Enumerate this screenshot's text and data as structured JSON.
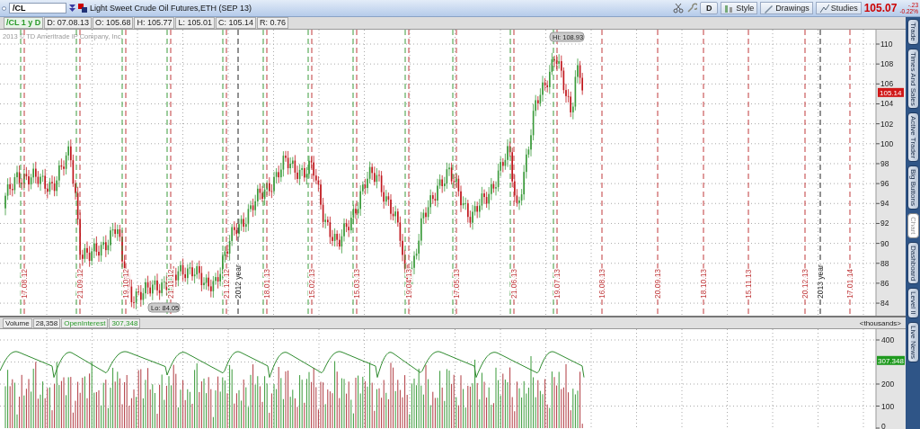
{
  "header": {
    "symbol": "/CL",
    "instrument": "Light Sweet Crude Oil Futures,ETH (SEP 13)",
    "toolbar": [
      {
        "label": "D",
        "kind": "period"
      },
      {
        "label": "Style",
        "kind": "style"
      },
      {
        "label": "Drawings",
        "kind": "drawings"
      },
      {
        "label": "Studies",
        "kind": "studies"
      }
    ],
    "last": "105.07",
    "change": "-.23",
    "change_pct": "-0.22%"
  },
  "quote_bar": [
    {
      "text": "/CL 1 y D",
      "kind": "symbol"
    },
    {
      "text": "D: 07.08.13",
      "kind": "field"
    },
    {
      "text": "O: 105.68",
      "kind": "field"
    },
    {
      "text": "H: 105.77",
      "kind": "field"
    },
    {
      "text": "L: 105.01",
      "kind": "field"
    },
    {
      "text": "C: 105.14",
      "kind": "field"
    },
    {
      "text": "R: 0.76",
      "kind": "field"
    }
  ],
  "price_chart": {
    "copyright": "2013 © TD Ameritrade IP Company, Inc.",
    "y_labels": [
      "110",
      "108",
      "106",
      "104",
      "102",
      "100",
      "98",
      "96",
      "94",
      "92",
      "90",
      "88",
      "86",
      "84"
    ],
    "current_price": "105.14",
    "high_label": "Hi: 108.93",
    "low_label": "Lo: 84.05",
    "date_markers": [
      {
        "label": "17.08.12",
        "kind": "date",
        "expiry": true
      },
      {
        "label": "21.09.12",
        "kind": "date",
        "expiry": true
      },
      {
        "label": "19.10.12",
        "kind": "date",
        "expiry": true
      },
      {
        "label": "21.11.12",
        "kind": "date",
        "expiry": true
      },
      {
        "label": "21.12.12",
        "kind": "date",
        "expiry": true
      },
      {
        "label": "2012 year",
        "kind": "year",
        "expiry": false
      },
      {
        "label": "18.01.13",
        "kind": "date",
        "expiry": true
      },
      {
        "label": "15.02.13",
        "kind": "date",
        "expiry": true
      },
      {
        "label": "15.03.13",
        "kind": "date",
        "expiry": true
      },
      {
        "label": "19.04.13",
        "kind": "date",
        "expiry": true
      },
      {
        "label": "17.05.13",
        "kind": "date",
        "expiry": true
      },
      {
        "label": "21.06.13",
        "kind": "date",
        "expiry": true
      },
      {
        "label": "19.07.13",
        "kind": "date",
        "expiry": true
      },
      {
        "label": "16.08.13",
        "kind": "date",
        "expiry": false
      },
      {
        "label": "20.09.13",
        "kind": "date",
        "expiry": false
      },
      {
        "label": "18.10.13",
        "kind": "date",
        "expiry": false
      },
      {
        "label": "15.11.13",
        "kind": "date",
        "expiry": false
      },
      {
        "label": "20.12.13",
        "kind": "date",
        "expiry": false
      },
      {
        "label": "2013 year",
        "kind": "year",
        "expiry": false
      },
      {
        "label": "17.01.14",
        "kind": "date",
        "expiry": false
      }
    ]
  },
  "volume_panel": {
    "volume_label": "Volume",
    "volume_value": "28,358",
    "oi_label": "OpenInterest",
    "oi_value": "307,348",
    "units": "<thousands>",
    "y_labels": [
      "400",
      "200",
      "100",
      "0"
    ],
    "oi_current": "307.348"
  },
  "side_tabs": [
    {
      "label": "Trade",
      "selected": false
    },
    {
      "label": "Times And Sales",
      "selected": false
    },
    {
      "label": "Active Trader",
      "selected": false
    },
    {
      "label": "Big Buttons",
      "selected": false
    },
    {
      "label": "Chart",
      "selected": true
    },
    {
      "label": "Dashboard",
      "selected": false
    },
    {
      "label": "Level II",
      "selected": false
    },
    {
      "label": "Live News",
      "selected": false
    }
  ]
}
